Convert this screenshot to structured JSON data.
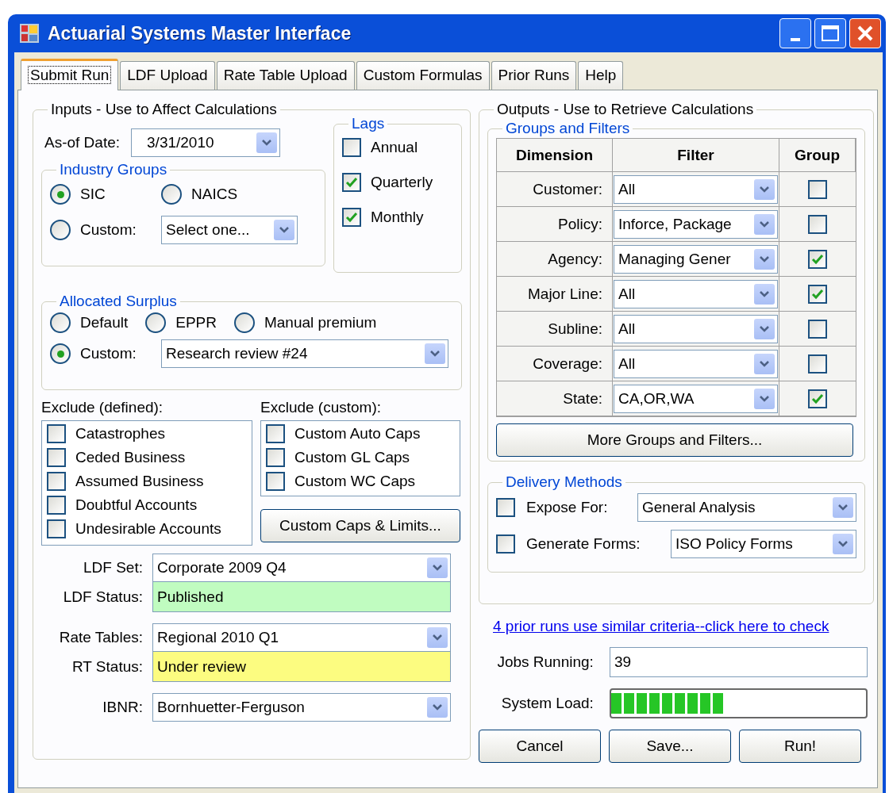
{
  "window": {
    "title": "Actuarial Systems Master Interface"
  },
  "tabs": [
    {
      "label": "Submit Run",
      "selected": true
    },
    {
      "label": "LDF Upload",
      "selected": false
    },
    {
      "label": "Rate Table Upload",
      "selected": false
    },
    {
      "label": "Custom Formulas",
      "selected": false
    },
    {
      "label": "Prior Runs",
      "selected": false
    },
    {
      "label": "Help",
      "selected": false
    }
  ],
  "inputs": {
    "title": "Inputs - Use to Affect Calculations",
    "as_of": {
      "label": "As-of Date:",
      "value": "3/31/2010"
    },
    "industry_groups": {
      "title": "Industry Groups",
      "options": [
        {
          "label": "SIC",
          "selected": true
        },
        {
          "label": "NAICS",
          "selected": false
        },
        {
          "label": "Custom:",
          "selected": false
        }
      ],
      "custom_select": "Select one..."
    },
    "lags": {
      "title": "Lags",
      "items": [
        {
          "label": "Annual",
          "checked": false
        },
        {
          "label": "Quarterly",
          "checked": true
        },
        {
          "label": "Monthly",
          "checked": true
        }
      ]
    },
    "allocated_surplus": {
      "title": "Allocated Surplus",
      "options": [
        {
          "label": "Default",
          "selected": false
        },
        {
          "label": "EPPR",
          "selected": false
        },
        {
          "label": "Manual premium",
          "selected": false
        },
        {
          "label": "Custom:",
          "selected": true
        }
      ],
      "custom_select": "Research review #24"
    },
    "exclude_defined": {
      "label": "Exclude (defined):",
      "items": [
        {
          "label": "Catastrophes",
          "checked": false
        },
        {
          "label": "Ceded Business",
          "checked": false
        },
        {
          "label": "Assumed Business",
          "checked": false
        },
        {
          "label": "Doubtful Accounts",
          "checked": false
        },
        {
          "label": "Undesirable Accounts",
          "checked": false
        }
      ]
    },
    "exclude_custom": {
      "label": "Exclude (custom):",
      "items": [
        {
          "label": "Custom Auto Caps",
          "checked": false
        },
        {
          "label": "Custom GL Caps",
          "checked": false
        },
        {
          "label": "Custom WC Caps",
          "checked": false
        }
      ]
    },
    "caps_button": "Custom Caps & Limits...",
    "fields": [
      {
        "kind": "select",
        "label": "LDF Set:",
        "value": "Corporate 2009 Q4"
      },
      {
        "kind": "status",
        "label": "LDF Status:",
        "value": "Published",
        "color": "#c0fcc0"
      },
      {
        "kind": "select",
        "label": "Rate Tables:",
        "value": "Regional 2010 Q1"
      },
      {
        "kind": "status",
        "label": "RT Status:",
        "value": "Under review",
        "color": "#fcfc80"
      },
      {
        "kind": "select",
        "label": "IBNR:",
        "value": "Bornhuetter-Ferguson"
      }
    ]
  },
  "outputs": {
    "title": "Outputs - Use to Retrieve Calculations",
    "groups_filters": {
      "title": "Groups and Filters",
      "columns": [
        "Dimension",
        "Filter",
        "Group"
      ],
      "rows": [
        {
          "dimension": "Customer:",
          "filter": "All",
          "group": false
        },
        {
          "dimension": "Policy:",
          "filter": "Inforce, Package",
          "group": false
        },
        {
          "dimension": "Agency:",
          "filter": "Managing Gener",
          "group": true
        },
        {
          "dimension": "Major Line:",
          "filter": "All",
          "group": true
        },
        {
          "dimension": "Subline:",
          "filter": "All",
          "group": false
        },
        {
          "dimension": "Coverage:",
          "filter": "All",
          "group": false
        },
        {
          "dimension": "State:",
          "filter": "CA,OR,WA",
          "group": true
        }
      ],
      "more_button": "More Groups and Filters..."
    },
    "delivery": {
      "title": "Delivery Methods",
      "items": [
        {
          "label": "Expose For:",
          "checked": false,
          "value": "General Analysis"
        },
        {
          "label": "Generate Forms:",
          "checked": false,
          "value": "ISO Policy Forms"
        }
      ]
    }
  },
  "prior_runs_link": "4 prior runs use similar criteria--click here to check",
  "jobs_running": {
    "label": "Jobs Running:",
    "value": "39"
  },
  "system_load": {
    "label": "System Load:",
    "level": 0.45
  },
  "buttons": [
    "Cancel",
    "Save...",
    "Run!"
  ]
}
